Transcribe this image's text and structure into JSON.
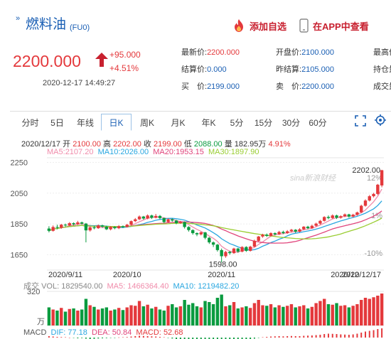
{
  "header": {
    "title_marker": "»",
    "title": "燃料油",
    "code": "(FU0)",
    "favorite_label": "添加自选",
    "app_label": "在APP中查看"
  },
  "quote": {
    "price": "2200.000",
    "change": "+95.000",
    "change_pct": "+4.51%",
    "timestamp": "2020-12-17 14:49:27",
    "stats": [
      {
        "label": "最新价:",
        "value": "2200.000",
        "tone": "red"
      },
      {
        "label": "开盘价:",
        "value": "2100.000",
        "tone": "blue"
      },
      {
        "label": "最高价",
        "value": "",
        "tone": "blue"
      },
      {
        "label": "结算价:",
        "value": "0.000",
        "tone": "blue"
      },
      {
        "label": "昨结算:",
        "value": "2105.000",
        "tone": "blue"
      },
      {
        "label": "持仓量",
        "value": "",
        "tone": "blue"
      },
      {
        "label": "买　价:",
        "value": "2199.000",
        "tone": "blue"
      },
      {
        "label": "卖　价:",
        "value": "2200.000",
        "tone": "blue"
      },
      {
        "label": "成交量",
        "value": "",
        "tone": "blue"
      }
    ]
  },
  "tabs": [
    "分时",
    "5日",
    "年线",
    "日K",
    "周K",
    "月K",
    "年K",
    "5分",
    "15分",
    "30分",
    "60分"
  ],
  "active_tab": "日K",
  "ohlc": {
    "date": "2020/12/17",
    "open_label": "开",
    "open": "2100.00",
    "high_label": "高",
    "high": "2202.00",
    "close_label": "收",
    "close": "2199.00",
    "low_label": "低",
    "low": "2088.00",
    "vol_label": "量",
    "vol": "182.95万",
    "pct": "4.91%"
  },
  "ma_legend": [
    {
      "label": "MA5:",
      "value": "2107.20",
      "color": "#f08cab"
    },
    {
      "label": "MA10:",
      "value": "2026.00",
      "color": "#2aa7e0"
    },
    {
      "label": "MA20:",
      "value": "1953.15",
      "color": "#e0447b"
    },
    {
      "label": "MA30:",
      "value": "1897.90",
      "color": "#9acd32"
    }
  ],
  "volume_legend": {
    "prefix": "成交",
    "vol_label": "VOL:",
    "vol": "1829540.00",
    "ma5_label": "MA5:",
    "ma5": "1466364.40",
    "ma10_label": "MA10:",
    "ma10": "1219482.20",
    "axis_top": "320",
    "axis_unit": "万"
  },
  "macd_legend": {
    "prefix": "MACD",
    "dif_label": "DIF:",
    "dif": "77.18",
    "dea_label": "DEA:",
    "dea": "50.84",
    "macd_label": "MACD:",
    "macd": "52.68"
  },
  "watermark": "sina新浪财经",
  "colors": {
    "up": "#e4393c",
    "down": "#0a9b3f",
    "accent": "#1a5fb4"
  },
  "chart_data": {
    "type": "candlestick",
    "price_ticks": [
      "2250",
      "2050",
      "1850",
      "1650"
    ],
    "price_tick_values": [
      2250,
      2050,
      1850,
      1650
    ],
    "pct_ticks": [
      "12%",
      "1%",
      "-10%"
    ],
    "ylim": [
      1550,
      2280
    ],
    "date_labels": [
      "2020/9/11",
      "2020/10",
      "2020/11",
      "2020/12",
      "2020/12/17"
    ],
    "date_label_index": [
      0,
      19,
      42,
      72,
      81
    ],
    "max_label": "2202.00",
    "min_label": "1598.00",
    "candles": [
      [
        1820,
        1805,
        1835,
        1795
      ],
      [
        1805,
        1830,
        1840,
        1800
      ],
      [
        1830,
        1825,
        1845,
        1815
      ],
      [
        1825,
        1845,
        1850,
        1818
      ],
      [
        1845,
        1840,
        1852,
        1832
      ],
      [
        1840,
        1855,
        1862,
        1835
      ],
      [
        1855,
        1848,
        1860,
        1840
      ],
      [
        1848,
        1860,
        1870,
        1842
      ],
      [
        1860,
        1852,
        1865,
        1845
      ],
      [
        1852,
        1808,
        1856,
        1730
      ],
      [
        1808,
        1828,
        1835,
        1800
      ],
      [
        1828,
        1822,
        1838,
        1815
      ],
      [
        1822,
        1840,
        1846,
        1818
      ],
      [
        1840,
        1832,
        1845,
        1825
      ],
      [
        1832,
        1815,
        1838,
        1810
      ],
      [
        1815,
        1830,
        1836,
        1808
      ],
      [
        1830,
        1822,
        1835,
        1815
      ],
      [
        1822,
        1835,
        1842,
        1816
      ],
      [
        1835,
        1830,
        1840,
        1824
      ],
      [
        1830,
        1845,
        1850,
        1826
      ],
      [
        1845,
        1868,
        1872,
        1840
      ],
      [
        1868,
        1880,
        1888,
        1862
      ],
      [
        1880,
        1898,
        1905,
        1875
      ],
      [
        1898,
        1885,
        1902,
        1878
      ],
      [
        1885,
        1905,
        1912,
        1880
      ],
      [
        1905,
        1890,
        1910,
        1882
      ],
      [
        1890,
        1902,
        1915,
        1886
      ],
      [
        1902,
        1888,
        1908,
        1880
      ],
      [
        1888,
        1862,
        1892,
        1855
      ],
      [
        1862,
        1880,
        1886,
        1858
      ],
      [
        1880,
        1872,
        1886,
        1865
      ],
      [
        1872,
        1855,
        1876,
        1848
      ],
      [
        1855,
        1862,
        1870,
        1850
      ],
      [
        1862,
        1830,
        1866,
        1820
      ],
      [
        1830,
        1810,
        1835,
        1800
      ],
      [
        1810,
        1790,
        1815,
        1780
      ],
      [
        1790,
        1782,
        1795,
        1770
      ],
      [
        1782,
        1795,
        1800,
        1775
      ],
      [
        1795,
        1760,
        1798,
        1750
      ],
      [
        1760,
        1730,
        1765,
        1720
      ],
      [
        1730,
        1715,
        1736,
        1700
      ],
      [
        1715,
        1680,
        1720,
        1670
      ],
      [
        1680,
        1640,
        1690,
        1600
      ],
      [
        1640,
        1668,
        1675,
        1630
      ],
      [
        1668,
        1660,
        1675,
        1650
      ],
      [
        1660,
        1690,
        1695,
        1655
      ],
      [
        1690,
        1670,
        1694,
        1662
      ],
      [
        1670,
        1700,
        1705,
        1665
      ],
      [
        1700,
        1675,
        1705,
        1668
      ],
      [
        1675,
        1702,
        1708,
        1670
      ],
      [
        1702,
        1740,
        1748,
        1698
      ],
      [
        1740,
        1768,
        1772,
        1735
      ],
      [
        1768,
        1780,
        1786,
        1760
      ],
      [
        1780,
        1772,
        1788,
        1765
      ],
      [
        1772,
        1790,
        1796,
        1768
      ],
      [
        1790,
        1782,
        1795,
        1775
      ],
      [
        1782,
        1798,
        1805,
        1778
      ],
      [
        1798,
        1790,
        1806,
        1784
      ],
      [
        1790,
        1802,
        1810,
        1785
      ],
      [
        1802,
        1812,
        1818,
        1795
      ],
      [
        1812,
        1800,
        1816,
        1792
      ],
      [
        1800,
        1815,
        1822,
        1795
      ],
      [
        1815,
        1832,
        1836,
        1810
      ],
      [
        1832,
        1822,
        1838,
        1815
      ],
      [
        1822,
        1838,
        1845,
        1818
      ],
      [
        1838,
        1852,
        1858,
        1832
      ],
      [
        1852,
        1870,
        1876,
        1845
      ],
      [
        1870,
        1895,
        1900,
        1865
      ],
      [
        1895,
        1888,
        1905,
        1880
      ],
      [
        1888,
        1905,
        1912,
        1882
      ],
      [
        1905,
        1890,
        1910,
        1882
      ],
      [
        1890,
        1900,
        1906,
        1884
      ],
      [
        1900,
        1912,
        1918,
        1894
      ],
      [
        1912,
        1898,
        1916,
        1890
      ],
      [
        1898,
        1910,
        1916,
        1892
      ],
      [
        1910,
        1925,
        1930,
        1904
      ],
      [
        1925,
        1968,
        1975,
        1920
      ],
      [
        1968,
        2002,
        2010,
        1962
      ],
      [
        2002,
        2030,
        2038,
        1996
      ],
      [
        2030,
        2045,
        2052,
        2022
      ],
      [
        2045,
        2105,
        2110,
        2038
      ],
      [
        2100,
        2199,
        2202,
        2088
      ]
    ],
    "volumes": [
      170,
      150,
      140,
      165,
      130,
      155,
      160,
      140,
      150,
      250,
      190,
      175,
      150,
      160,
      170,
      140,
      150,
      165,
      145,
      170,
      190,
      185,
      230,
      180,
      195,
      160,
      175,
      150,
      140,
      185,
      200,
      170,
      180,
      240,
      195,
      210,
      180,
      170,
      230,
      220,
      200,
      260,
      290,
      180,
      190,
      220,
      160,
      170,
      180,
      165,
      210,
      240,
      190,
      185,
      200,
      170,
      190,
      175,
      185,
      200,
      170,
      180,
      190,
      160,
      175,
      210,
      230,
      250,
      200,
      195,
      210,
      185,
      190,
      170,
      185,
      200,
      240,
      260,
      250,
      265,
      280,
      300
    ],
    "macd": [
      8,
      6,
      4,
      3,
      2,
      0,
      -2,
      -4,
      -3,
      -6,
      -8,
      -7,
      -5,
      -4,
      -3,
      -2,
      -1,
      1,
      2,
      3,
      6,
      8,
      10,
      9,
      8,
      7,
      6,
      4,
      2,
      -2,
      -5,
      -8,
      -10,
      -14,
      -18,
      -20,
      -22,
      -20,
      -24,
      -26,
      -28,
      -30,
      -34,
      -30,
      -26,
      -22,
      -20,
      -16,
      -14,
      -10,
      -6,
      -2,
      2,
      4,
      6,
      7,
      8,
      7,
      8,
      9,
      8,
      8,
      10,
      11,
      12,
      14,
      16,
      20,
      22,
      21,
      20,
      18,
      17,
      16,
      18,
      22,
      28,
      34,
      38,
      42,
      48,
      52
    ]
  }
}
